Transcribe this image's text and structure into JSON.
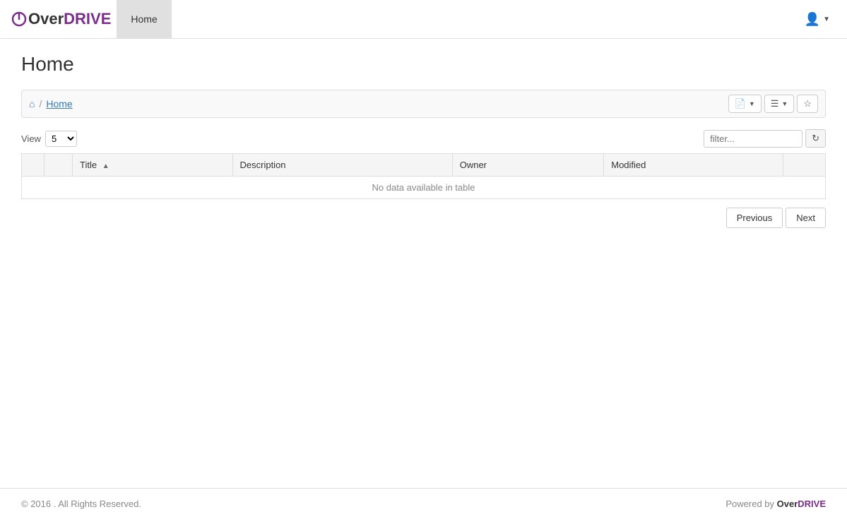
{
  "brand": {
    "name_over": "Over",
    "name_drive": "DRIVE"
  },
  "navbar": {
    "home_tab": "Home",
    "user_icon": "👤"
  },
  "page": {
    "title": "Home"
  },
  "breadcrumb": {
    "home_label": "Home"
  },
  "toolbar": {
    "doc_button_title": "Document options",
    "list_button_title": "List options",
    "star_button_title": "Favorites"
  },
  "view": {
    "label": "View",
    "count": "5"
  },
  "filter": {
    "placeholder": "filter..."
  },
  "table": {
    "columns": [
      "",
      "Title",
      "Description",
      "Owner",
      "Modified",
      ""
    ],
    "no_data_message": "No data available in table"
  },
  "pagination": {
    "previous": "Previous",
    "next": "Next"
  },
  "footer": {
    "copyright": "© 2016 . All Rights Reserved.",
    "powered_by": "Powered by ",
    "brand_over": "Over",
    "brand_drive": "DRIVE"
  }
}
